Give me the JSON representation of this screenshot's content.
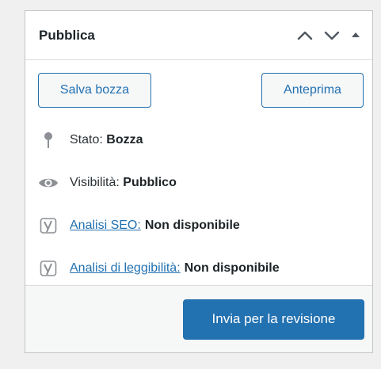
{
  "panel": {
    "title": "Pubblica",
    "controls": [
      {
        "name": "move-up",
        "icon": "chevron-up-icon"
      },
      {
        "name": "move-down",
        "icon": "chevron-down-icon"
      },
      {
        "name": "toggle-panel",
        "icon": "caret-up-icon"
      }
    ]
  },
  "actions": {
    "save_draft": "Salva bozza",
    "preview": "Anteprima"
  },
  "status": {
    "label": "Stato:",
    "value": "Bozza",
    "icon": "pin-icon"
  },
  "visibility": {
    "label": "Visibilità:",
    "value": "Pubblico",
    "icon": "eye-icon"
  },
  "seo": {
    "link": "Analisi SEO:",
    "value": "Non disponibile",
    "icon": "yoast-icon"
  },
  "readability": {
    "link": "Analisi di leggibilità:",
    "value": "Non disponibile",
    "icon": "yoast-icon"
  },
  "footer": {
    "submit": "Invia per la revisione"
  },
  "colors": {
    "primary": "#2271b1",
    "icon": "#8c8f94",
    "panel_bg": "#ffffff",
    "page_bg": "#f0f0f1",
    "footer_bg": "#f6f7f7"
  }
}
